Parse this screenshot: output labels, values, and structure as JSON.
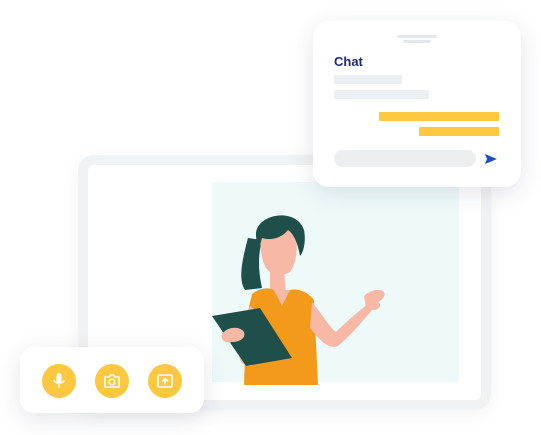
{
  "chat": {
    "title": "Chat",
    "input_placeholder": ""
  },
  "controls": {
    "items": [
      {
        "name": "microphone-icon"
      },
      {
        "name": "camera-icon"
      },
      {
        "name": "screen-share-icon"
      }
    ]
  },
  "colors": {
    "accent": "#fdc740",
    "chat_title": "#1e2a78",
    "send_icon": "#1e4fc2",
    "video_background": "#eefafa",
    "frame": "#f1f2f4",
    "presenter_hair": "#1f4f4a",
    "presenter_top": "#f39a1b",
    "presenter_skin": "#f7b9a5"
  }
}
